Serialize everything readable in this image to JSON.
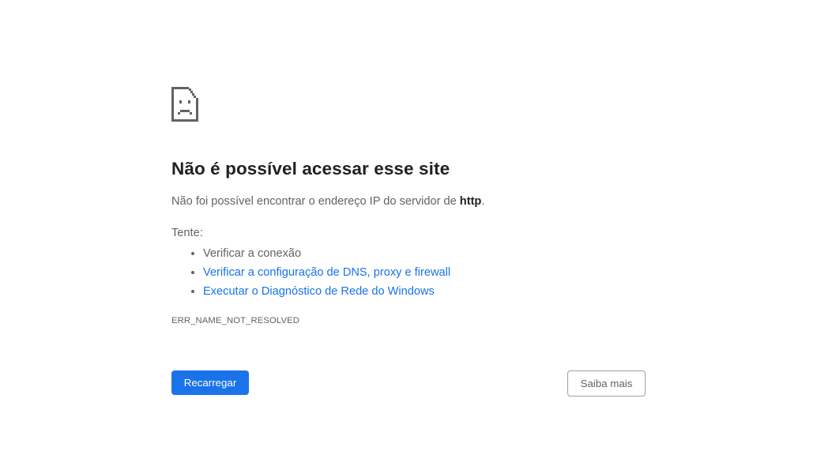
{
  "icon": {
    "name": "sad-document-icon",
    "color": "#5f6368"
  },
  "error": {
    "title": "Não é possível acessar esse site",
    "summary_prefix": "Não foi possível encontrar o endereço IP do servidor de ",
    "summary_host": "http",
    "summary_suffix": ".",
    "try_label": "Tente:",
    "suggestions": [
      {
        "text": "Verificar a conexão",
        "is_link": false
      },
      {
        "text": "Verificar a configuração de DNS, proxy e firewall",
        "is_link": true
      },
      {
        "text": "Executar o Diagnóstico de Rede do Windows",
        "is_link": true
      }
    ],
    "code": "ERR_NAME_NOT_RESOLVED"
  },
  "buttons": {
    "reload_label": "Recarregar",
    "details_label": "Saiba mais"
  },
  "colors": {
    "accent": "#1a73e8",
    "title_text": "#202124",
    "body_text": "#5f6368",
    "border": "#9aa0a6",
    "background": "#ffffff"
  }
}
